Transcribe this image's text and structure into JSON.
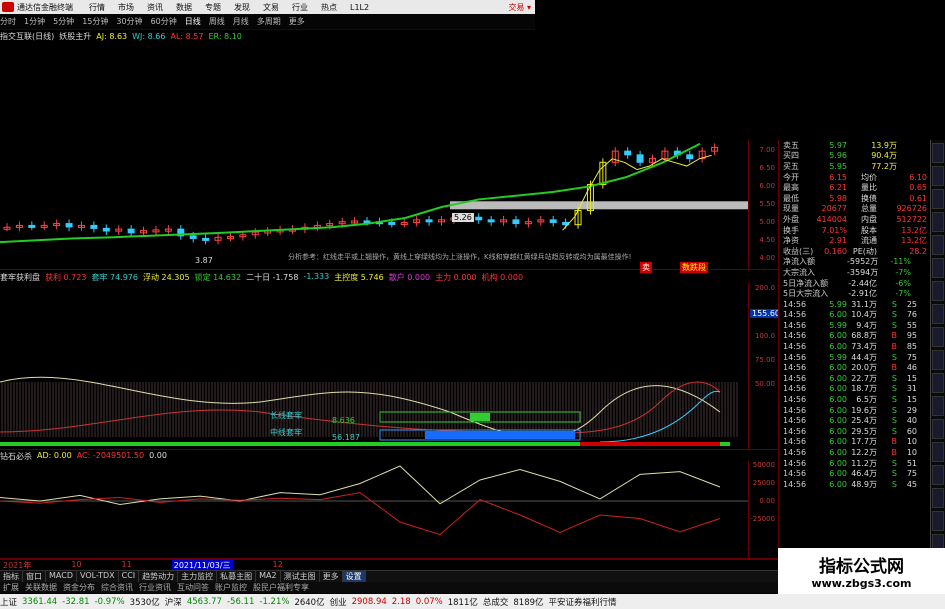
{
  "topbar": {
    "title": "通达信金融终端",
    "menu": [
      "行情",
      "市场",
      "资讯",
      "数据",
      "专题",
      "发现",
      "文易",
      "行业",
      "热点",
      "L1L2"
    ],
    "trade": "交易 ▾"
  },
  "periods": [
    "分时",
    "1分钟",
    "5分钟",
    "15分钟",
    "30分钟",
    "60分钟",
    "日线",
    "周线",
    "月线",
    "多周期",
    "更多"
  ],
  "active_period": "日线",
  "info": {
    "name": "指交互联(日线)",
    "item2": "妖股主升",
    "aj": "AJ: 8.63",
    "wj": "WJ: 8.66",
    "al": "AL: 8.57",
    "er": "ER: 8.10"
  },
  "price_axis": [
    "7.00",
    "6.50",
    "6.00",
    "5.50",
    "5.00",
    "4.50",
    "4.00"
  ],
  "main_labels": {
    "high_mark": "5.26",
    "low_mark": "3.87",
    "note": "分析参考：红线走平或上翘操作，黄线上穿绿线均为上涨操作，K线和穿越红黄绿兵站趋反转或均为属最佳操作!",
    "tag1": "卖",
    "tag2": "数跌段"
  },
  "ind1": {
    "name": "套牢获利盘",
    "items": [
      {
        "l": "获利",
        "v": "0.723"
      },
      {
        "l": "套牢",
        "v": "74.976"
      },
      {
        "l": "浮动",
        "v": "24.305"
      },
      {
        "l": "锁定",
        "v": "14.632"
      },
      {
        "l": "二十日",
        "v": "-1.758"
      },
      {
        "l": "",
        "v": "-1.333"
      },
      {
        "l": "主控度",
        "v": "5.746"
      },
      {
        "l": "散户",
        "v": "0.000"
      },
      {
        "l": "主力",
        "v": "0.000"
      },
      {
        "l": "机构",
        "v": "0.000"
      }
    ],
    "axis": [
      "200.0",
      "150.0",
      "100.0",
      "75.00",
      "50.00"
    ],
    "highlight": "155.60",
    "lab_a": "长线套牢",
    "lab_b": "中线套牢",
    "val_a": "8.636",
    "val_b": "56.187"
  },
  "ind2": {
    "name": "钻石必杀",
    "ad": "AD: 0.00",
    "ac": "AC: -2049501.50",
    "zero": "0.00",
    "axis": [
      "50000",
      "25000",
      "0.00",
      "-25000"
    ]
  },
  "dates": [
    "2021年",
    "10",
    "11",
    "2021/11/03/三",
    "12"
  ],
  "tabs": [
    "指标",
    "窗口",
    "MACD",
    "VOL-TDX",
    "CCI",
    "趋势动力",
    "主力监控",
    "私募主图",
    "MA2",
    "测试主图",
    "更多",
    "设置"
  ],
  "subtabs": [
    "扩展",
    "关联数据",
    "资金分布",
    "综合资讯",
    "行业资讯",
    "互动问答",
    "账户监控",
    "股民户福利专享"
  ],
  "quote": {
    "top": [
      {
        "l": "卖五",
        "p": "5.97",
        "v": "13.9万"
      },
      {
        "l": "买四",
        "p": "5.96",
        "v": "90.4万"
      },
      {
        "l": "买五",
        "p": "5.95",
        "v": "77.2万"
      }
    ],
    "stats": [
      {
        "l": "今开",
        "v": "6.15",
        "l2": "均价",
        "v2": "6.10"
      },
      {
        "l": "最高",
        "v": "6.21",
        "l2": "量比",
        "v2": "0.65"
      },
      {
        "l": "最低",
        "v": "5.98",
        "l2": "换债",
        "v2": "0.61"
      },
      {
        "l": "现量",
        "v": "20677",
        "l2": "总量",
        "v2": "926726"
      },
      {
        "l": "外盘",
        "v": "414004",
        "l2": "内盘",
        "v2": "512722"
      },
      {
        "l": "换手",
        "v": "7.01%",
        "l2": "股本",
        "v2": "13.2亿"
      },
      {
        "l": "净资",
        "v": "2.91",
        "l2": "流通",
        "v2": "13.2亿"
      },
      {
        "l": "收益(三)",
        "v": "0.160",
        "l2": "PE(动)",
        "v2": "28.2"
      }
    ],
    "flow": [
      {
        "l": "净流入额",
        "v": "-5952万",
        "p": "-11%"
      },
      {
        "l": "大宗流入",
        "v": "-3594万",
        "p": "-7%"
      },
      {
        "l": "5日净流入额",
        "v": "-2.44亿",
        "p": "-6%"
      },
      {
        "l": "5日大宗流入",
        "v": "-2.91亿",
        "p": "-7%"
      }
    ],
    "ticks": [
      [
        "14:56",
        "5.99",
        "31.1万",
        "S",
        "25"
      ],
      [
        "14:56",
        "6.00",
        "10.4万",
        "S",
        "76"
      ],
      [
        "14:56",
        "5.99",
        "9.4万",
        "S",
        "55"
      ],
      [
        "14:56",
        "6.00",
        "68.8万",
        "B",
        "95"
      ],
      [
        "14:56",
        "6.00",
        "73.4万",
        "B",
        "85"
      ],
      [
        "14:56",
        "5.99",
        "44.4万",
        "S",
        "75"
      ],
      [
        "14:56",
        "6.00",
        "20.0万",
        "B",
        "46"
      ],
      [
        "14:56",
        "6.00",
        "22.7万",
        "S",
        "15"
      ],
      [
        "14:56",
        "6.00",
        "18.7万",
        "S",
        "31"
      ],
      [
        "14:56",
        "6.00",
        "6.5万",
        "S",
        "15"
      ],
      [
        "14:56",
        "6.00",
        "19.6万",
        "S",
        "29"
      ],
      [
        "14:56",
        "6.00",
        "25.4万",
        "S",
        "40"
      ],
      [
        "14:56",
        "6.00",
        "29.5万",
        "S",
        "60"
      ],
      [
        "14:56",
        "6.00",
        "17.7万",
        "B",
        "10"
      ],
      [
        "14:56",
        "6.00",
        "12.2万",
        "B",
        "10"
      ],
      [
        "14:56",
        "6.00",
        "11.2万",
        "S",
        "51"
      ],
      [
        "14:56",
        "6.00",
        "46.4万",
        "S",
        "75"
      ],
      [
        "14:56",
        "6.00",
        "48.9万",
        "S",
        "45"
      ]
    ]
  },
  "status": {
    "sh": "上证",
    "sh_v": "3361.44",
    "sh_c": "-32.81",
    "sh_p": "-0.97%",
    "sh_a": "3530亿",
    "sz": "沪深",
    "sz_v": "4563.77",
    "sz_c": "-56.11",
    "sz_p": "-1.21%",
    "sz_a": "2640亿",
    "cy": "创业",
    "cy_v": "2908.94",
    "cy_c": "2.18",
    "cy_p": "0.07%",
    "cy_a": "1811亿",
    "tot": "总成交",
    "tot_v": "8189亿",
    "news": "平安证券福利行情"
  },
  "watermark": {
    "t1": "指标公式网",
    "t2": "www.zbgs3.com"
  },
  "chart_data": {
    "type": "candlestick",
    "ylim": [
      3.7,
      7.2
    ],
    "candles": [
      4.85,
      4.9,
      4.88,
      4.9,
      4.95,
      4.86,
      4.9,
      4.82,
      4.75,
      4.8,
      4.7,
      4.76,
      4.78,
      4.8,
      4.62,
      4.55,
      4.5,
      4.58,
      4.6,
      4.65,
      4.72,
      4.75,
      4.78,
      4.8,
      4.85,
      4.9,
      4.95,
      5.0,
      5.02,
      5.0,
      4.98,
      4.95,
      4.98,
      5.05,
      5.0,
      5.05,
      5.1,
      5.12,
      5.05,
      5.0,
      5.05,
      4.95,
      5.0,
      5.05,
      4.98,
      4.92,
      5.3,
      6.0,
      6.6,
      6.9,
      6.8,
      6.6,
      6.7,
      6.9,
      6.8,
      6.7,
      6.9,
      7.0
    ],
    "ma_green": [
      4.45,
      4.5,
      4.55,
      4.58,
      4.62,
      4.66,
      4.7,
      4.75,
      4.8,
      4.85,
      4.95,
      5.1,
      5.4,
      5.6,
      5.7,
      5.8,
      5.95,
      6.2,
      6.6,
      7.1
    ],
    "ind2_line1": [
      5000,
      0,
      8000,
      -5000,
      3000,
      7000,
      0,
      12000,
      9000,
      25000,
      50000,
      -4000,
      30000,
      45000,
      28000,
      3000,
      38000,
      42000,
      20000
    ],
    "ind2_line2": [
      0,
      -3000,
      2000,
      5000,
      -2000,
      3000,
      1000,
      4000,
      2000,
      12000,
      -30000,
      -48000,
      2000,
      -20000,
      -45000,
      -20000,
      -25000,
      -44000,
      -25000
    ]
  }
}
